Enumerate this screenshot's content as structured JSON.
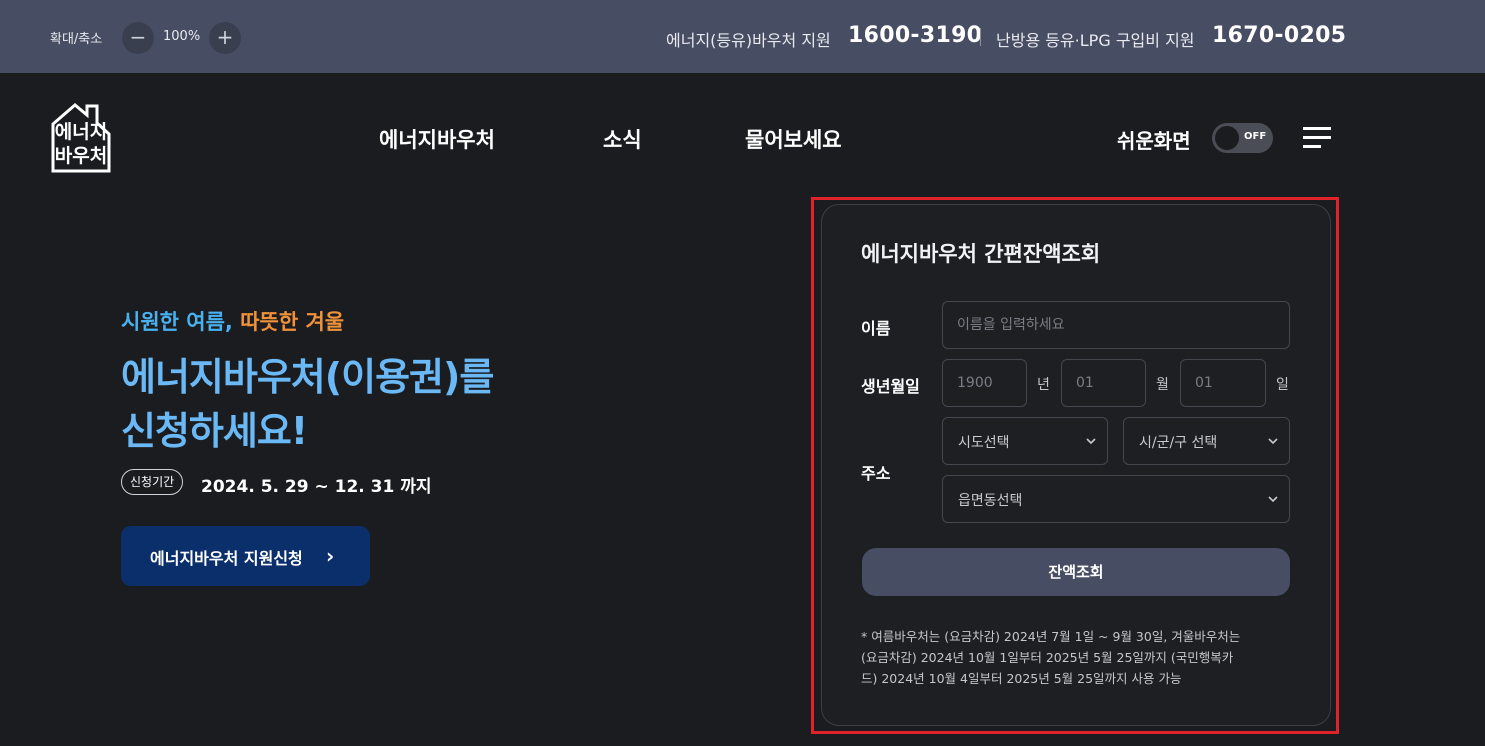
{
  "topbar": {
    "zoom_label": "확대/축소",
    "zoom_minus": "−",
    "zoom_value": "100%",
    "zoom_plus": "+",
    "hotline1_label": "에너지(등유)바우처 지원",
    "hotline1_number": "1600-3190",
    "hotline2_label": "난방용 등유·LPG 구입비 지원",
    "hotline2_number": "1670-0205"
  },
  "header": {
    "logo_line1": "에너지",
    "logo_line2": "바우처",
    "nav": [
      "에너지바우처",
      "소식",
      "물어보세요"
    ],
    "easy_mode_label": "쉬운화면",
    "easy_mode_toggle": "OFF"
  },
  "hero": {
    "tag_blue": "시원한 여름,",
    "tag_orange": "따뜻한 겨울",
    "title_line1": "에너지바우처(이용권)를",
    "title_line2": "신청하세요!",
    "period_badge": "신청기간",
    "period_text": "2024. 5. 29 ~ 12. 31 까지",
    "apply_button": "에너지바우처 지원신청",
    "apply_chevron": "›"
  },
  "balance_form": {
    "title": "에너지바우처 간편잔액조회",
    "name_label": "이름",
    "name_placeholder": "이름을 입력하세요",
    "birth_label": "생년월일",
    "year_placeholder": "1900",
    "year_unit": "년",
    "month_placeholder": "01",
    "month_unit": "월",
    "day_placeholder": "01",
    "day_unit": "일",
    "address_label": "주소",
    "sido_select": "시도선택",
    "sigungu_select": "시/군/구 선택",
    "eupmyeondong_select": "읍면동선택",
    "search_button": "잔액조회",
    "note_line1": "* 여름바우처는 (요금차감) 2024년 7월 1일 ~ 9월 30일, 겨울바우처는",
    "note_line2": "(요금차감) 2024년 10월 1일부터 2025년 5월 25일까지 (국민행복카",
    "note_line3": "드) 2024년 10월 4일부터 2025년 5월 25일까지 사용 가능"
  },
  "colors": {
    "topbar_bg": "#474d62",
    "page_bg": "#1b1c1f",
    "hero_title": "#6ab8f5",
    "tag_blue": "#4ab1f0",
    "tag_orange": "#f0923a",
    "apply_button_bg": "#0b2f6b",
    "highlight_border": "#e0232b"
  }
}
